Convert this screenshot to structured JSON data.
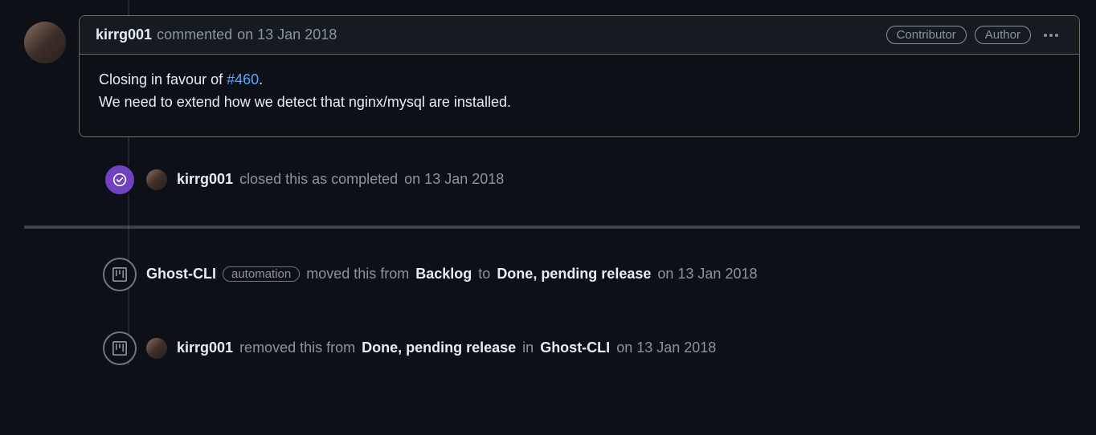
{
  "comment": {
    "author": "kirrg001",
    "action_prefix": "commented",
    "date": "on 13 Jan 2018",
    "badges": [
      "Contributor",
      "Author"
    ],
    "body_line1_prefix": "Closing in favour of ",
    "body_line1_link": "#460",
    "body_line1_suffix": ".",
    "body_line2": "We need to extend how we detect that nginx/mysql are installed."
  },
  "event_closed": {
    "author": "kirrg001",
    "action": "closed this as completed",
    "date": "on 13 Jan 2018"
  },
  "event_moved": {
    "project": "Ghost-CLI",
    "tag": "automation",
    "action_prefix": "moved this from",
    "from": "Backlog",
    "mid": "to",
    "to": "Done, pending release",
    "date": "on 13 Jan 2018"
  },
  "event_removed": {
    "author": "kirrg001",
    "action_prefix": "removed this from",
    "from": "Done, pending release",
    "mid": "in",
    "project": "Ghost-CLI",
    "date": "on 13 Jan 2018"
  }
}
